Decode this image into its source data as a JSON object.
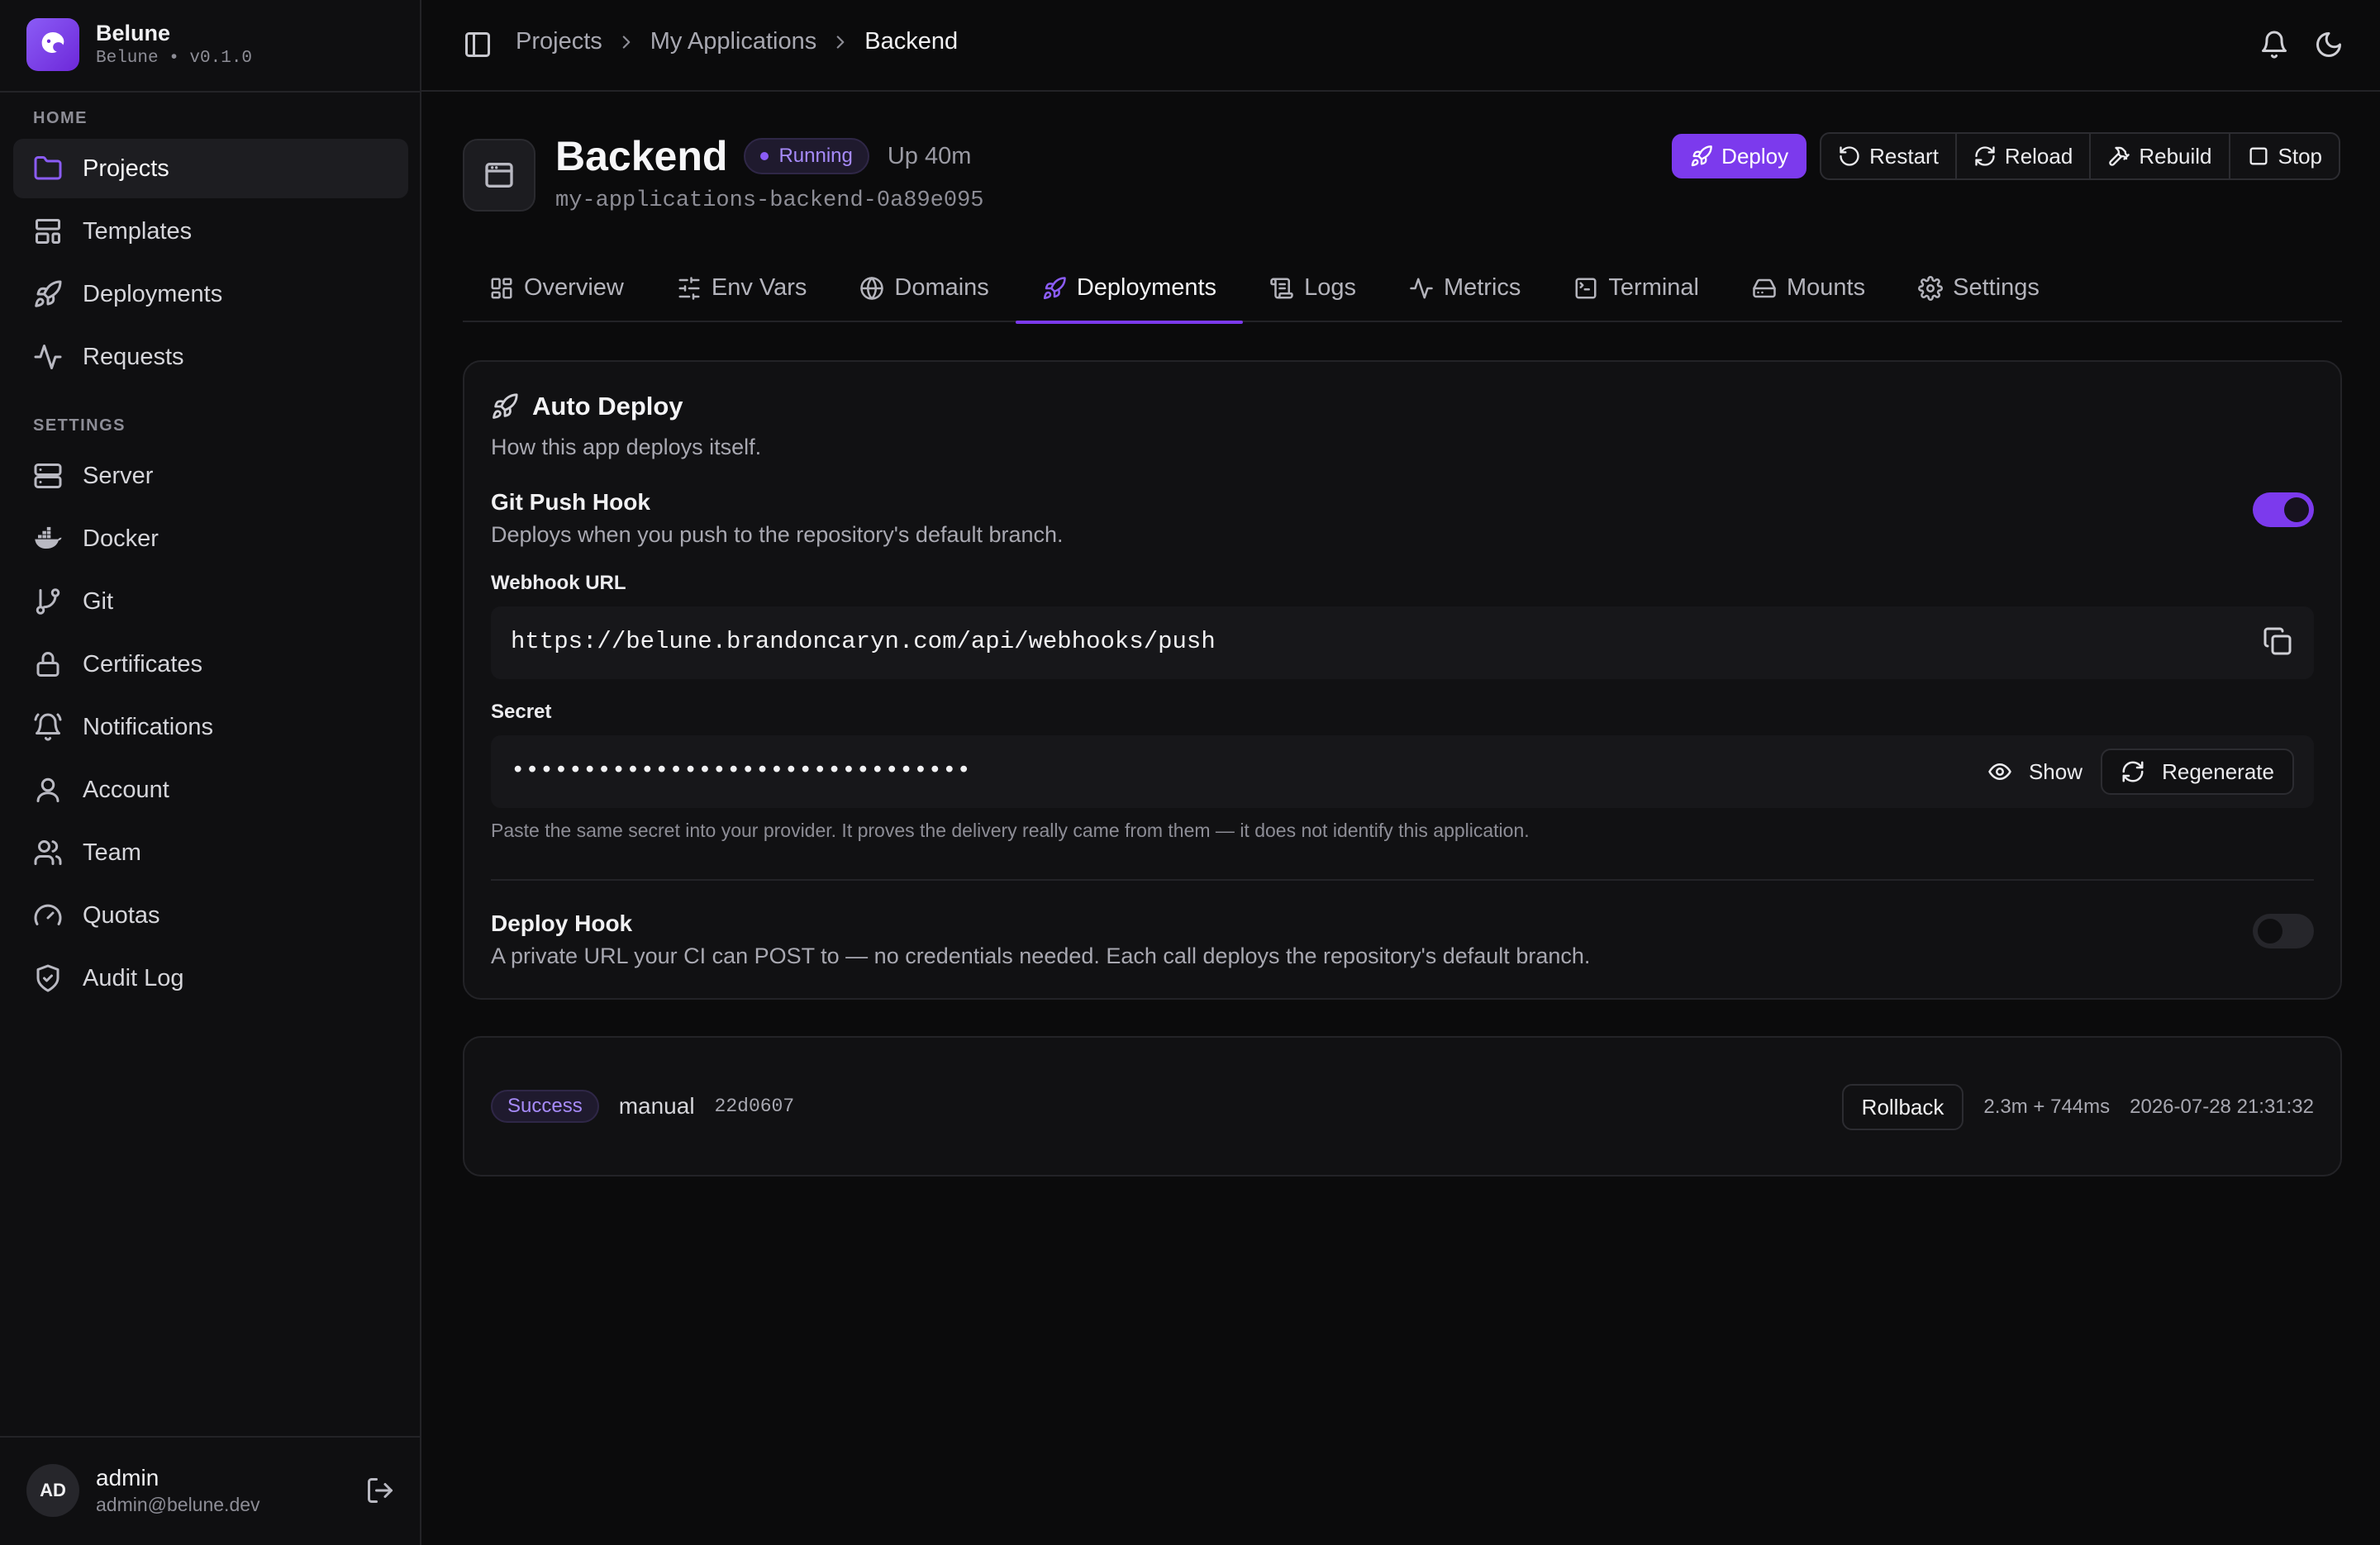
{
  "app": {
    "name": "Belune",
    "version": "Belune • v0.1.0"
  },
  "sidebar": {
    "home_label": "HOME",
    "home_items": [
      {
        "label": "Projects",
        "icon": "folder-icon",
        "active": true
      },
      {
        "label": "Templates",
        "icon": "layout-template-icon"
      },
      {
        "label": "Deployments",
        "icon": "rocket-icon"
      },
      {
        "label": "Requests",
        "icon": "activity-icon"
      }
    ],
    "settings_label": "SETTINGS",
    "settings_items": [
      {
        "label": "Server",
        "icon": "server-icon"
      },
      {
        "label": "Docker",
        "icon": "docker-icon"
      },
      {
        "label": "Git",
        "icon": "git-branch-icon"
      },
      {
        "label": "Certificates",
        "icon": "lock-icon"
      },
      {
        "label": "Notifications",
        "icon": "bell-icon"
      },
      {
        "label": "Account",
        "icon": "user-icon"
      },
      {
        "label": "Team",
        "icon": "users-icon"
      },
      {
        "label": "Quotas",
        "icon": "gauge-icon"
      },
      {
        "label": "Audit Log",
        "icon": "shield-check-icon"
      }
    ],
    "user": {
      "initials": "AD",
      "name": "admin",
      "email": "admin@belune.dev"
    }
  },
  "topbar": {
    "breadcrumbs": [
      "Projects",
      "My Applications",
      "Backend"
    ]
  },
  "header": {
    "title": "Backend",
    "status": "Running",
    "uptime": "Up 40m",
    "slug": "my-applications-backend-0a89e095",
    "actions": {
      "deploy": "Deploy",
      "restart": "Restart",
      "reload": "Reload",
      "rebuild": "Rebuild",
      "stop": "Stop"
    }
  },
  "tabs": [
    {
      "label": "Overview",
      "icon": "overview-icon"
    },
    {
      "label": "Env Vars",
      "icon": "sliders-icon"
    },
    {
      "label": "Domains",
      "icon": "globe-icon"
    },
    {
      "label": "Deployments",
      "icon": "rocket-icon",
      "active": true
    },
    {
      "label": "Logs",
      "icon": "scroll-icon"
    },
    {
      "label": "Metrics",
      "icon": "activity-icon"
    },
    {
      "label": "Terminal",
      "icon": "terminal-icon"
    },
    {
      "label": "Mounts",
      "icon": "hard-drive-icon"
    },
    {
      "label": "Settings",
      "icon": "gear-icon"
    }
  ],
  "auto_deploy": {
    "title": "Auto Deploy",
    "description": "How this app deploys itself.",
    "git_push_hook": {
      "title": "Git Push Hook",
      "description": "Deploys when you push to the repository's default branch.",
      "enabled": true
    },
    "webhook_url_label": "Webhook URL",
    "webhook_url": "https://belune.brandoncaryn.com/api/webhooks/push",
    "secret_label": "Secret",
    "secret_masked": "••••••••••••••••••••••••••••••••",
    "show_label": "Show",
    "regenerate_label": "Regenerate",
    "secret_hint": "Paste the same secret into your provider. It proves the delivery really came from them — it does not identify this application.",
    "deploy_hook": {
      "title": "Deploy Hook",
      "description": "A private URL your CI can POST to — no credentials needed. Each call deploys the repository's default branch.",
      "enabled": false
    }
  },
  "deployments": [
    {
      "status": "Success",
      "trigger": "manual",
      "commit": "22d0607",
      "rollback_label": "Rollback",
      "duration": "2.3m + 744ms",
      "timestamp": "2026-07-28 21:31:32"
    }
  ],
  "colors": {
    "accent": "#7c3aed",
    "accent_text": "#a78bfa",
    "background": "#0b0b0c",
    "card": "#111113"
  }
}
